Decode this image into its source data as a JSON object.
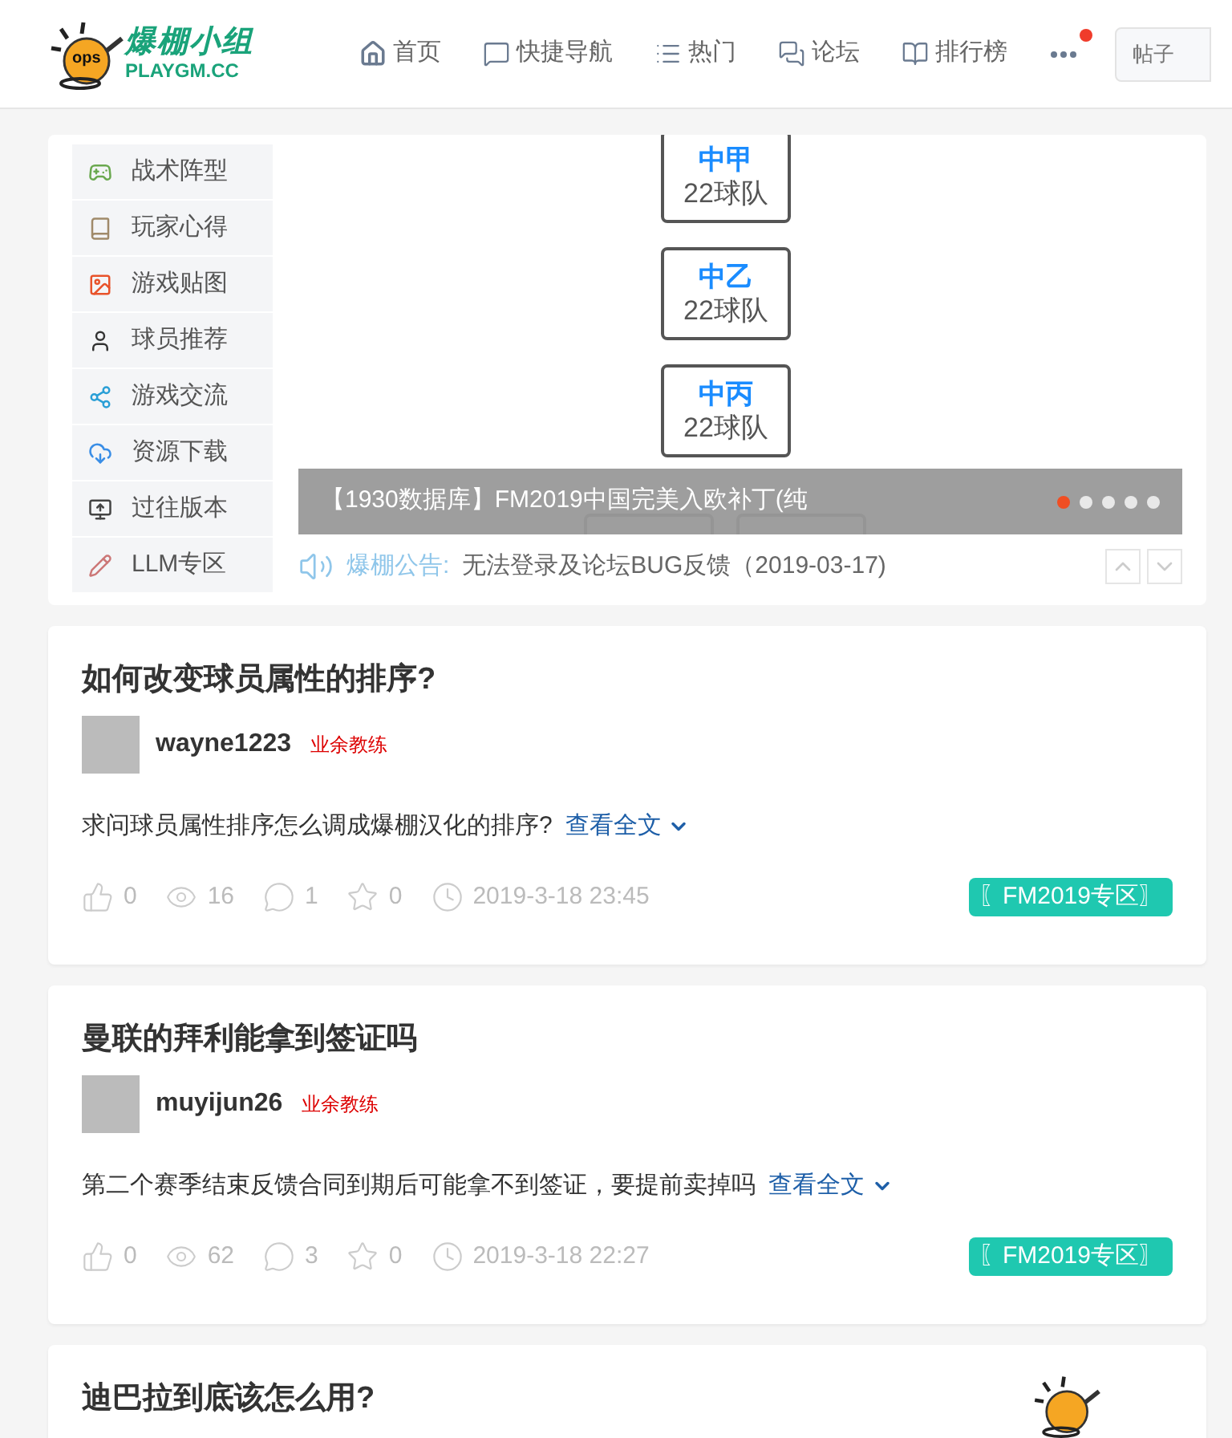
{
  "header": {
    "logo_text": "爆棚小组",
    "logo_domain": "PLAYGM.CC",
    "logo_badge": "ops",
    "nav": [
      {
        "label": "首页"
      },
      {
        "label": "快捷导航"
      },
      {
        "label": "热门"
      },
      {
        "label": "论坛"
      },
      {
        "label": "排行榜"
      }
    ],
    "more_has_notification": true,
    "search": {
      "placeholder": "帖子"
    }
  },
  "sidebar": {
    "items": [
      {
        "label": "战术阵型"
      },
      {
        "label": "玩家心得"
      },
      {
        "label": "游戏贴图"
      },
      {
        "label": "球员推荐"
      },
      {
        "label": "游戏交流"
      },
      {
        "label": "资源下载"
      },
      {
        "label": "过往版本"
      },
      {
        "label": "LLM专区"
      }
    ]
  },
  "slider": {
    "boxes": [
      {
        "name": "中甲",
        "count": "22球队"
      },
      {
        "name": "中乙",
        "count": "22球队"
      },
      {
        "name": "中丙",
        "count": "22球队"
      }
    ],
    "caption": "【1930数据库】FM2019中国完美入欧补丁(纯",
    "dots": [
      {
        "selected": true
      },
      {
        "selected": false
      },
      {
        "selected": false
      },
      {
        "selected": false
      },
      {
        "selected": false
      }
    ]
  },
  "notice": {
    "label": "爆棚公告:",
    "text": "无法登录及论坛BUG反馈（2019-03-17)"
  },
  "posts": [
    {
      "title": "如何改变球员属性的排序?",
      "author": "wayne1223",
      "rank": "业余教练",
      "excerpt": "求问球员属性排序怎么调成爆棚汉化的排序?",
      "more": "查看全文",
      "likes": "0",
      "views": "16",
      "comments": "1",
      "favorites": "0",
      "time": "2019-3-18 23:45",
      "tag": "〖FM2019专区〗"
    },
    {
      "title": "曼联的拜利能拿到签证吗",
      "author": "muyijun26",
      "rank": "业余教练",
      "excerpt": "第二个赛季结束反馈合同到期后可能拿不到签证，要提前卖掉吗",
      "more": "查看全文",
      "likes": "0",
      "views": "62",
      "comments": "3",
      "favorites": "0",
      "time": "2019-3-18 22:27",
      "tag": "〖FM2019专区〗"
    },
    {
      "title": "迪巴拉到底该怎么用?"
    }
  ]
}
